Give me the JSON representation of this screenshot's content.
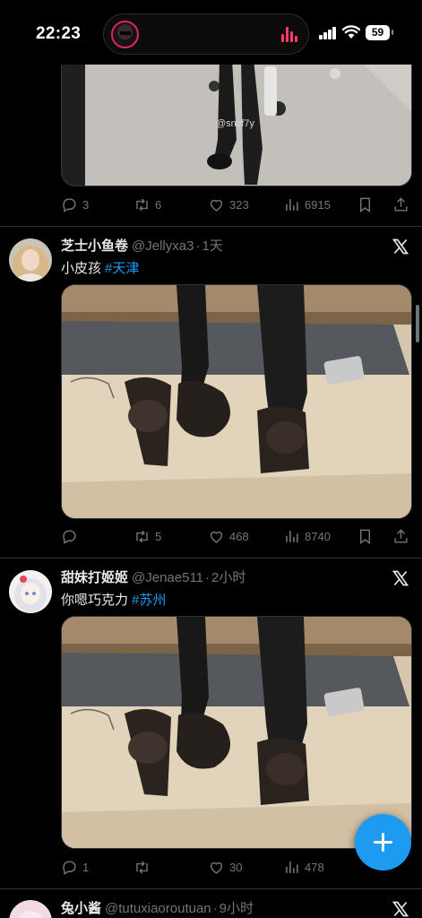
{
  "status_bar": {
    "time": "22:23",
    "battery": "59"
  },
  "tweets": [
    {
      "partial": true,
      "actions": {
        "replies": "3",
        "reposts": "6",
        "likes": "323",
        "views": "6915"
      },
      "watermark": "@sncf7y"
    },
    {
      "name": "芝士小鱼卷",
      "handle": "@Jellyxa3",
      "separator": "·",
      "time": "1天",
      "text": "小皮孩",
      "hashtag": "#天津",
      "actions": {
        "replies": "",
        "reposts": "5",
        "likes": "468",
        "views": "8740"
      }
    },
    {
      "name": "甜妹打姬姬",
      "handle": "@Jenae511",
      "separator": "·",
      "time": "2小时",
      "text": "你嗯巧克力",
      "hashtag": "#苏州",
      "actions": {
        "replies": "1",
        "reposts": "",
        "likes": "30",
        "views": "478"
      }
    },
    {
      "name": "兔小酱",
      "handle": "@tutuxiaoroutuan",
      "separator": "·",
      "time": "9小时"
    }
  ],
  "colors": {
    "accent": "#1d9bf0",
    "muted": "#71767b",
    "divider": "#2f3336",
    "background": "#000000"
  },
  "icons": [
    "reply-icon",
    "repost-icon",
    "like-icon",
    "views-icon",
    "bookmark-icon",
    "share-icon",
    "x-logo-icon",
    "compose-plus-icon"
  ]
}
